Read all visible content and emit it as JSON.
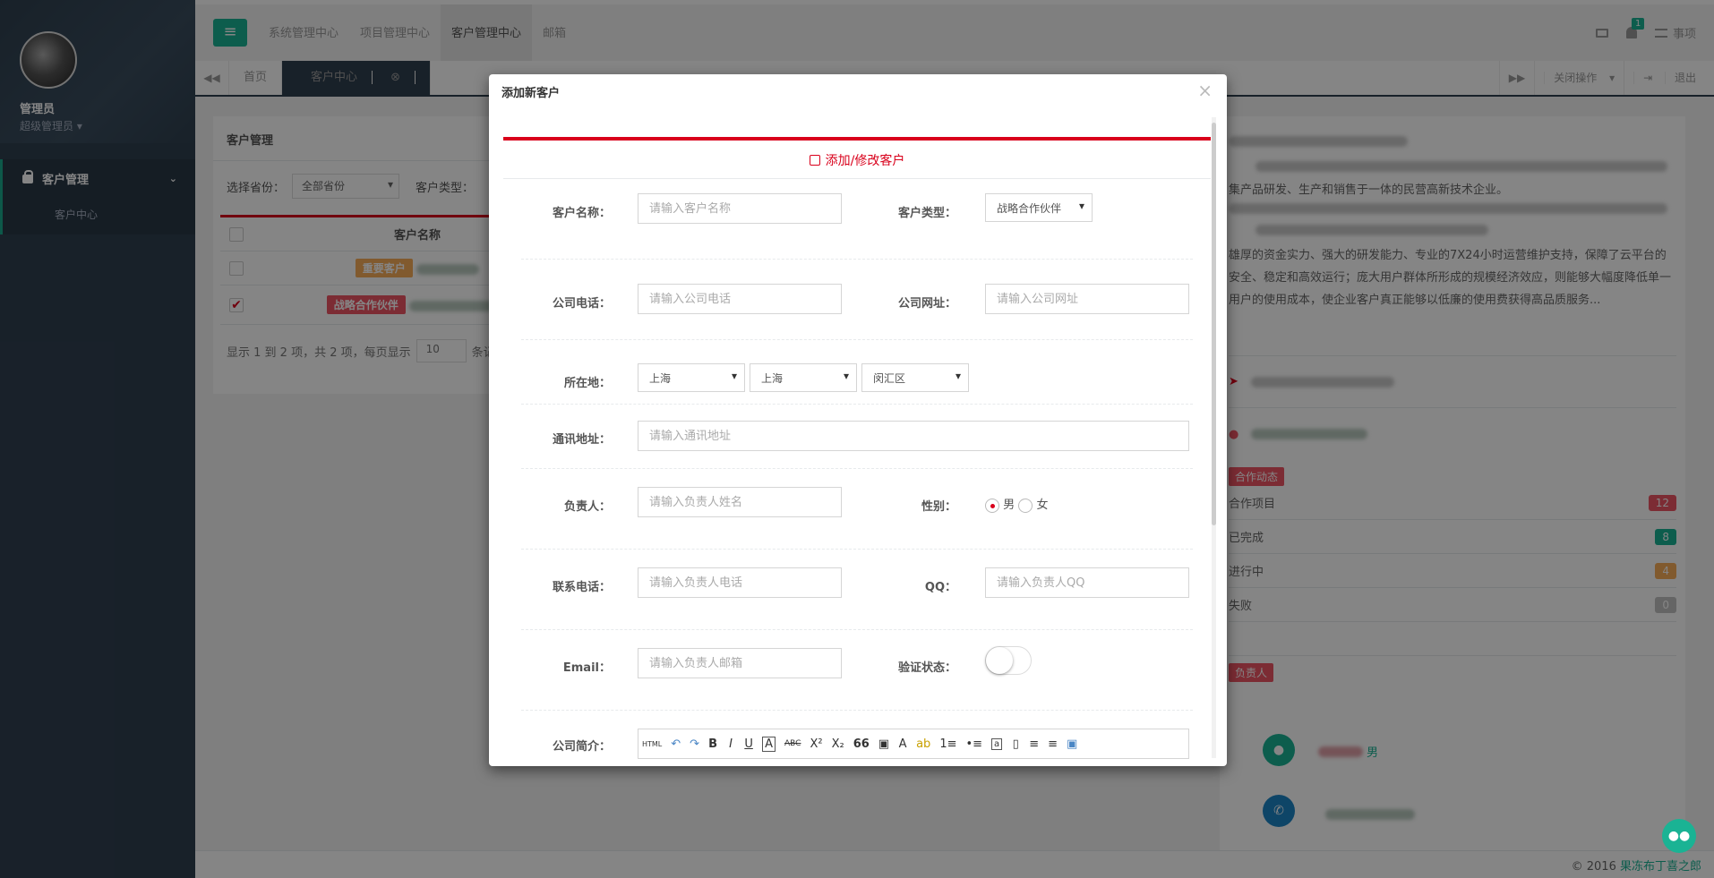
{
  "sidebar": {
    "user_name": "管理员",
    "user_role": "超级管理员",
    "nav": [
      {
        "label": "客户管理",
        "children": [
          {
            "label": "客户中心"
          }
        ]
      }
    ]
  },
  "topnav": {
    "items": [
      "系统管理中心",
      "项目管理中心",
      "客户管理中心",
      "邮箱"
    ],
    "active_index": 2,
    "notification_count": "1",
    "task_label": "事项"
  },
  "tabbar": {
    "tabs": [
      "首页",
      "客户中心"
    ],
    "close_ops_label": "关闭操作",
    "logout_label": "退出"
  },
  "customer_panel": {
    "title": "客户管理",
    "province_label": "选择省份：",
    "province_value": "全部省份",
    "type_label": "客户类型：",
    "column_name": "客户名称",
    "rows": [
      {
        "tag": "重要客户",
        "checked": false
      },
      {
        "tag": "战略合作伙伴",
        "checked": true
      }
    ],
    "pager_text": "显示 1 到 2 项，共 2 项，每页显示",
    "page_size": "10",
    "pager_suffix": "条记"
  },
  "detail_panel": {
    "intro_lines": [
      "集产品研发、生产和销售于一体的民营高新技术企业。",
      "雄厚的资金实力、强大的研发能力、专业的7X24小时运营维护支持，保障了云平台的安全、稳定和高效运行；庞大用户群体所形成的规模经济效应，则能够大幅度降低单一用户的使用成本，使企业客户真正能够以低廉的使用费获得高品质服务..."
    ],
    "cooperation_label": "合作动态",
    "stats": [
      {
        "label": "合作项目",
        "value": "12",
        "color": "#ed5565"
      },
      {
        "label": "已完成",
        "value": "8",
        "color": "#1ab394"
      },
      {
        "label": "进行中",
        "value": "4",
        "color": "#f8ac59"
      },
      {
        "label": "失败",
        "value": "0",
        "color": "#c2c2c2"
      }
    ],
    "owner_label": "负责人",
    "owner_gender": "男"
  },
  "footer": {
    "copyright": "© 2016 ",
    "brand": "果冻布丁喜之郎"
  },
  "modal": {
    "title": "添加新客户",
    "close_glyph": "×",
    "form_title": "添加/修改客户",
    "fields": {
      "customer_name": {
        "label": "客户名称：",
        "placeholder": "请输入客户名称"
      },
      "customer_type": {
        "label": "客户类型：",
        "value": "战略合作伙伴"
      },
      "company_phone": {
        "label": "公司电话：",
        "placeholder": "请输入公司电话"
      },
      "company_url": {
        "label": "公司网址：",
        "placeholder": "请输入公司网址"
      },
      "location": {
        "label": "所在地：",
        "province": "上海",
        "city": "上海",
        "district": "闵汇区"
      },
      "address": {
        "label": "通讯地址：",
        "placeholder": "请输入通讯地址"
      },
      "owner": {
        "label": "负责人：",
        "placeholder": "请输入负责人姓名"
      },
      "gender": {
        "label": "性别：",
        "male": "男",
        "female": "女",
        "selected": "男"
      },
      "contact_phone": {
        "label": "联系电话：",
        "placeholder": "请输入负责人电话"
      },
      "qq": {
        "label": "QQ：",
        "placeholder": "请输入负责人QQ"
      },
      "email": {
        "label": "Email：",
        "placeholder": "请输入负责人邮箱"
      },
      "verify": {
        "label": "验证状态：",
        "on": false
      },
      "intro": {
        "label": "公司简介："
      }
    },
    "editor_toolbar": [
      "HTML",
      "↶",
      "↷",
      "B",
      "I",
      "U",
      "A",
      "ABC",
      "X²",
      "X₂",
      "66",
      "▣",
      "A",
      "ab",
      "1≡",
      "•≡",
      "a",
      "▯",
      "≡",
      "≡",
      "▣"
    ]
  },
  "colors": {
    "accent": "#1ab394",
    "danger": "#d9001b",
    "sidebar": "#2f4050"
  }
}
